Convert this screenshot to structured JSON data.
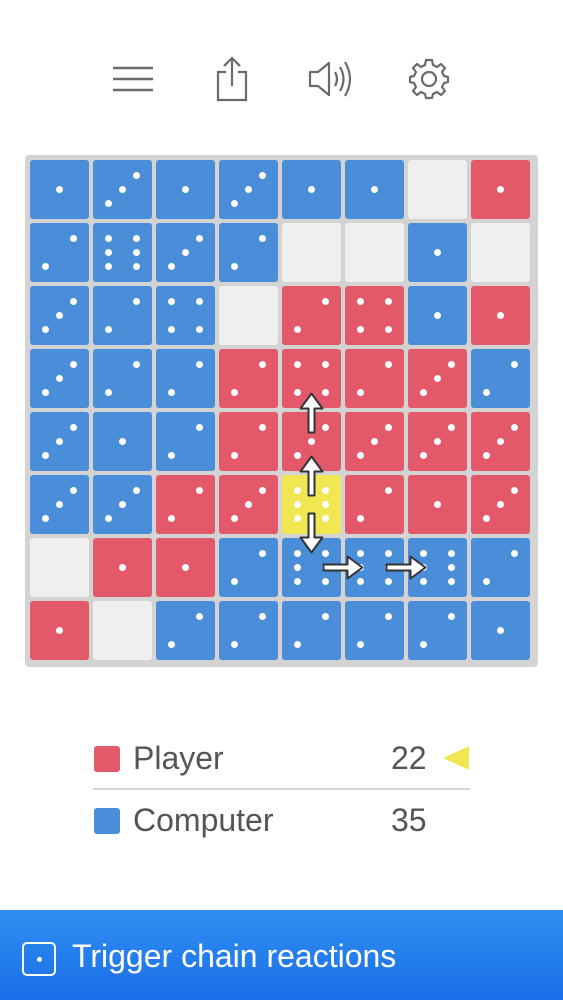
{
  "toolbar": {
    "icons": [
      "menu-icon",
      "share-icon",
      "sound-icon",
      "settings-icon"
    ]
  },
  "colors": {
    "blue": "#4a8ed9",
    "red": "#e4596a",
    "empty": "#efefef",
    "highlight": "#f1e752",
    "banner": "#2a86ee"
  },
  "board": {
    "rows": 8,
    "cols": 8,
    "cells": [
      [
        {
          "c": "B",
          "v": 1
        },
        {
          "c": "B",
          "v": 3
        },
        {
          "c": "B",
          "v": 1
        },
        {
          "c": "B",
          "v": 3
        },
        {
          "c": "B",
          "v": 1
        },
        {
          "c": "B",
          "v": 1
        },
        {
          "c": "E",
          "v": 0
        },
        {
          "c": "R",
          "v": 1
        }
      ],
      [
        {
          "c": "B",
          "v": 2
        },
        {
          "c": "B",
          "v": 6
        },
        {
          "c": "B",
          "v": 3
        },
        {
          "c": "B",
          "v": 2
        },
        {
          "c": "E",
          "v": 0
        },
        {
          "c": "E",
          "v": 0
        },
        {
          "c": "B",
          "v": 1
        },
        {
          "c": "E",
          "v": 0
        }
      ],
      [
        {
          "c": "B",
          "v": 3
        },
        {
          "c": "B",
          "v": 2
        },
        {
          "c": "B",
          "v": 4
        },
        {
          "c": "E",
          "v": 0
        },
        {
          "c": "R",
          "v": 2
        },
        {
          "c": "R",
          "v": 4
        },
        {
          "c": "B",
          "v": 1
        },
        {
          "c": "R",
          "v": 1
        }
      ],
      [
        {
          "c": "B",
          "v": 3
        },
        {
          "c": "B",
          "v": 2
        },
        {
          "c": "B",
          "v": 2
        },
        {
          "c": "R",
          "v": 2
        },
        {
          "c": "R",
          "v": 4
        },
        {
          "c": "R",
          "v": 2
        },
        {
          "c": "R",
          "v": 3
        },
        {
          "c": "B",
          "v": 2
        }
      ],
      [
        {
          "c": "B",
          "v": 3
        },
        {
          "c": "B",
          "v": 1
        },
        {
          "c": "B",
          "v": 2
        },
        {
          "c": "R",
          "v": 2
        },
        {
          "c": "R",
          "v": 3
        },
        {
          "c": "R",
          "v": 3
        },
        {
          "c": "R",
          "v": 3
        },
        {
          "c": "R",
          "v": 3
        }
      ],
      [
        {
          "c": "B",
          "v": 3
        },
        {
          "c": "B",
          "v": 3
        },
        {
          "c": "R",
          "v": 2
        },
        {
          "c": "R",
          "v": 3
        },
        {
          "c": "Y",
          "v": 6
        },
        {
          "c": "R",
          "v": 2
        },
        {
          "c": "R",
          "v": 1
        },
        {
          "c": "R",
          "v": 3
        }
      ],
      [
        {
          "c": "E",
          "v": 0
        },
        {
          "c": "R",
          "v": 1
        },
        {
          "c": "R",
          "v": 1
        },
        {
          "c": "B",
          "v": 2
        },
        {
          "c": "B",
          "v": 6
        },
        {
          "c": "B",
          "v": 6
        },
        {
          "c": "B",
          "v": 6
        },
        {
          "c": "B",
          "v": 2
        }
      ],
      [
        {
          "c": "R",
          "v": 1
        },
        {
          "c": "E",
          "v": 0
        },
        {
          "c": "B",
          "v": 2
        },
        {
          "c": "B",
          "v": 2
        },
        {
          "c": "B",
          "v": 2
        },
        {
          "c": "B",
          "v": 2
        },
        {
          "c": "B",
          "v": 2
        },
        {
          "c": "B",
          "v": 1
        }
      ]
    ],
    "chain_arrows": [
      {
        "row": 4,
        "col": 4,
        "dir": "up"
      },
      {
        "row": 5,
        "col": 4,
        "dir": "up"
      },
      {
        "row": 5,
        "col": 4,
        "dir": "down"
      },
      {
        "row": 6,
        "col": 4,
        "dir": "right"
      },
      {
        "row": 6,
        "col": 5,
        "dir": "right"
      }
    ]
  },
  "scores": {
    "player": {
      "label": "Player",
      "value": "22",
      "color": "#e4596a",
      "active_turn": true
    },
    "computer": {
      "label": "Computer",
      "value": "35",
      "color": "#4a8ed9",
      "active_turn": false
    }
  },
  "banner": {
    "text": "Trigger chain reactions",
    "icon": "die-one-icon"
  }
}
